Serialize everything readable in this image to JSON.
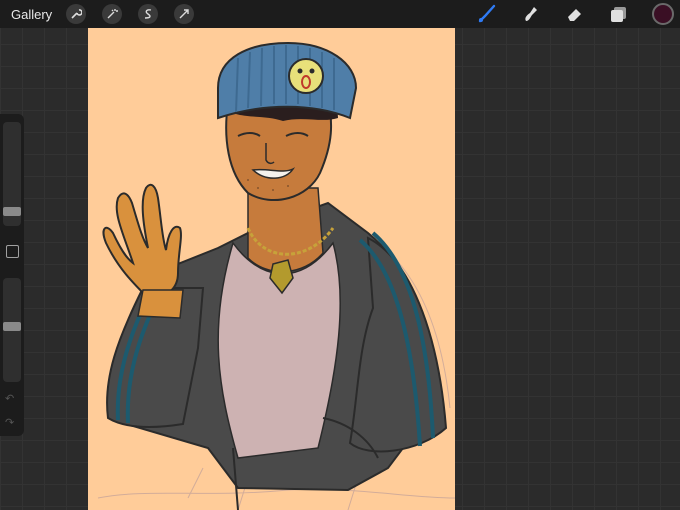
{
  "topbar": {
    "gallery_label": "Gallery",
    "left_tools": [
      "wrench-icon",
      "magic-wand-icon",
      "selection-icon",
      "transform-icon"
    ],
    "right_tools": [
      "brush-icon",
      "smudge-icon",
      "eraser-icon",
      "layers-icon"
    ],
    "active_tool": "brush",
    "active_tool_color": "#2f7bf5",
    "current_color": "#3a0f24"
  },
  "sidebar": {
    "brush_size_slider": "brush-size",
    "opacity_slider": "opacity",
    "modify_button": "modify",
    "undo": "undo",
    "redo": "redo"
  },
  "canvas": {
    "background_color": "#ffcc99",
    "artwork": "illustration"
  }
}
